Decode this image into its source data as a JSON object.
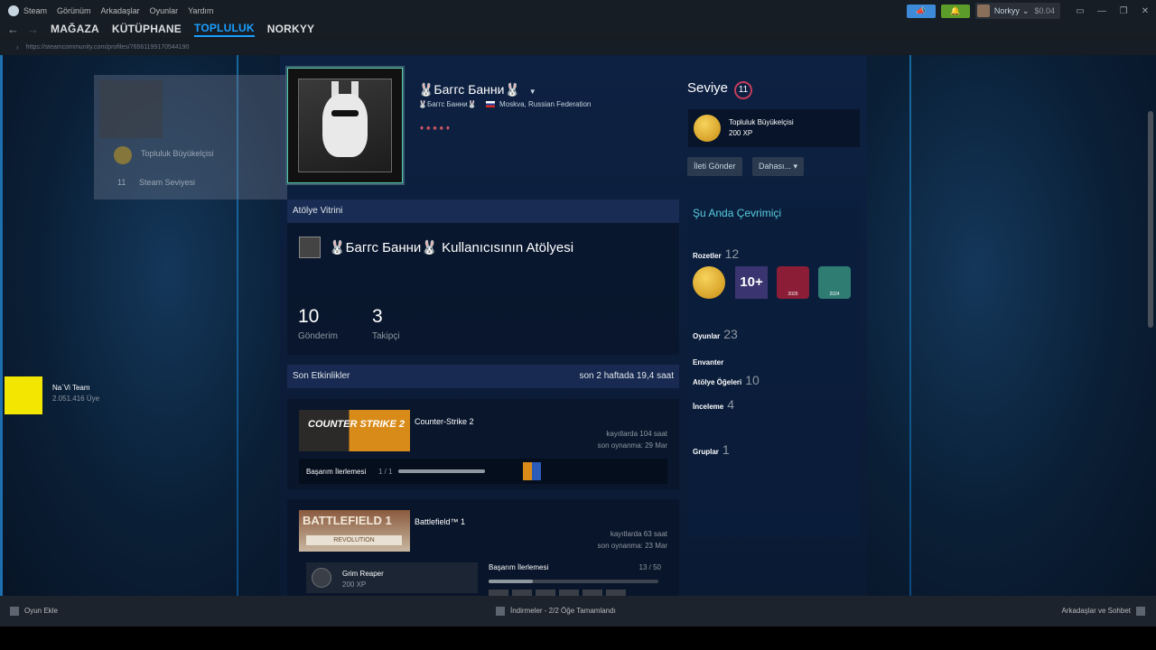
{
  "menu": {
    "app": "Steam",
    "items": [
      "Görünüm",
      "Arkadaşlar",
      "Oyunlar",
      "Yardım"
    ]
  },
  "account": {
    "name": "Norkyy",
    "wallet": "$0.04"
  },
  "nav": {
    "items": [
      "MAĞAZA",
      "KÜTÜPHANE",
      "TOPLULUK",
      "NORKYY"
    ],
    "active": "TOPLULUK"
  },
  "url": "https://steamcommunity.com/profiles/76561199170544190",
  "ghost": {
    "badge": "Topluluk Büyükelçisi",
    "level_num": "11",
    "level_lbl": "Steam Seviyesi"
  },
  "profile": {
    "name": "🐰Баггс Банни🐰",
    "sub_name": "🐰Баггс Банни🐰",
    "location": "Moskva, Russian Federation"
  },
  "level": {
    "label": "Seviye",
    "value": "11"
  },
  "fav_badge": {
    "name": "Topluluk Büyükelçisi",
    "xp": "200 XP"
  },
  "buttons": {
    "message": "İleti Gönder",
    "more": "Dahası... ▾"
  },
  "right": {
    "online": "Şu Anda Çevrimiçi",
    "badges_label": "Rozetler",
    "badges_count": "12",
    "badge_years": [
      "2025",
      "2024"
    ],
    "badge_10": "10+",
    "games_label": "Oyunlar",
    "games_count": "23",
    "inventory_label": "Envanter",
    "workshop_label": "Atölye Öğeleri",
    "workshop_count": "10",
    "review_label": "İnceleme",
    "review_count": "4",
    "groups_label": "Gruplar",
    "groups_count": "1",
    "group_name": "Na`Vi Team",
    "group_members": "2.051.416 Üye"
  },
  "showcase": {
    "header": "Atölye Vitrini",
    "title": "🐰Баггс Банни🐰 Kullanıcısının Atölyesi",
    "stats": [
      {
        "n": "10",
        "l": "Gönderim"
      },
      {
        "n": "3",
        "l": "Takipçi"
      }
    ]
  },
  "activity": {
    "header": "Son Etkinlikler",
    "hours": "son 2 haftada 19,4 saat",
    "games": [
      {
        "name": "Counter-Strike 2",
        "hours": "kayıtlarda 104 saat",
        "last": "son oynanma: 29 Mar",
        "ach_label": "Başarım İlerlemesi",
        "ach_count": "1 / 1",
        "cap": "COUNTER STRIKE 2",
        "progress": 1.0
      },
      {
        "name": "Battlefield™ 1",
        "hours": "kayıtlarda 63 saat",
        "last": "son oynanma: 23 Mar",
        "ach_label": "Başarım İlerlemesi",
        "ach_count": "13 / 50",
        "cap": "BATTLEFIELD 1",
        "cap_sub": "REVOLUTION",
        "rare_name": "Grim Reaper",
        "rare_xp": "200 XP",
        "progress": 0.26
      }
    ]
  },
  "footer": {
    "add": "Oyun Ekle",
    "downloads": "İndirmeler - 2/2 Öğe Tamamlandı",
    "friends": "Arkadaşlar ve Sohbet"
  }
}
